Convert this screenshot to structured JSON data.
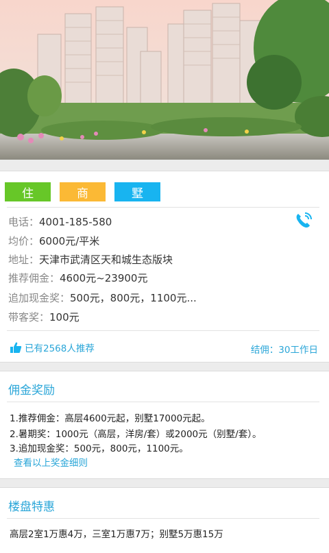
{
  "hero": {
    "alt": "楼盘效果图"
  },
  "tags": [
    {
      "label": "住",
      "color": "#67c728"
    },
    {
      "label": "商",
      "color": "#fbb935"
    },
    {
      "label": "墅",
      "color": "#18b4f0"
    }
  ],
  "info": {
    "phone_label": "电话：",
    "phone": "4001-185-580",
    "price_label": "均价：",
    "price": "6000元/平米",
    "address_label": "地址：",
    "address": "天津市武清区天和城生态版块",
    "commission_label": "推荐佣金：",
    "commission": "4600元~23900元",
    "cash_bonus_label": "追加现金奖：",
    "cash_bonus": "500元，800元，1100元...",
    "visit_bonus_label": "带客奖：",
    "visit_bonus": "100元",
    "recommend_count": "已有2568人推荐",
    "settlement": "结佣：30工作日"
  },
  "bonus": {
    "title": "佣金奖励",
    "lines": [
      "1.推荐佣金：高层4600元起，别墅17000元起。",
      "2.暑期奖：1000元（高层，洋房/套）或2000元（别墅/套）。",
      "3.追加现金奖：500元，800元，1100元。"
    ],
    "detail_link": "查看以上奖金细则"
  },
  "promo": {
    "title": "楼盘特惠",
    "line": "高层2室1万惠4万，三室1万惠7万；别墅5万惠15万"
  },
  "colors": {
    "accent": "#2aa6d8",
    "background": "#ececec"
  }
}
